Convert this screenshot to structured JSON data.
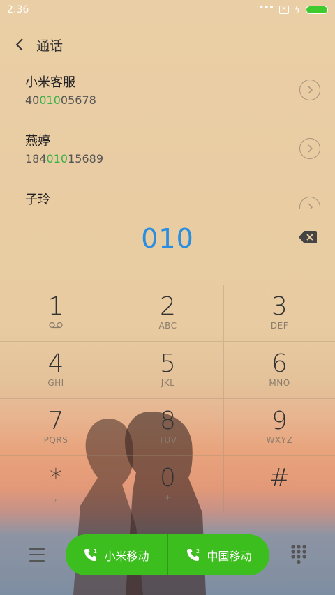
{
  "status_bar": {
    "time": "2:36"
  },
  "header": {
    "title": "通话"
  },
  "contacts": [
    {
      "name": "小米客服",
      "num_pre": "40",
      "num_match": "010",
      "num_post": "05678"
    },
    {
      "name": "燕婷",
      "num_pre": "184",
      "num_match": "010",
      "num_post": "15689"
    },
    {
      "name": "子玲",
      "num_pre": "",
      "num_match": "",
      "num_post": ""
    }
  ],
  "dialed_number": "010",
  "keypad": [
    {
      "digit": "1",
      "letters": ""
    },
    {
      "digit": "2",
      "letters": "ABC"
    },
    {
      "digit": "3",
      "letters": "DEF"
    },
    {
      "digit": "4",
      "letters": "GHI"
    },
    {
      "digit": "5",
      "letters": "JKL"
    },
    {
      "digit": "6",
      "letters": "MNO"
    },
    {
      "digit": "7",
      "letters": "PQRS"
    },
    {
      "digit": "8",
      "letters": "TUV"
    },
    {
      "digit": "9",
      "letters": "WXYZ"
    },
    {
      "digit": "*",
      "letters": ","
    },
    {
      "digit": "0",
      "letters": "+"
    },
    {
      "digit": "#",
      "letters": ""
    }
  ],
  "call_buttons": {
    "sim1_label": "小米移动",
    "sim2_label": "中国移动"
  },
  "colors": {
    "accent_blue": "#2a8ee0",
    "match_green": "#3ab24a",
    "call_green": "#3cbf1e",
    "battery_green": "#3fca30"
  }
}
